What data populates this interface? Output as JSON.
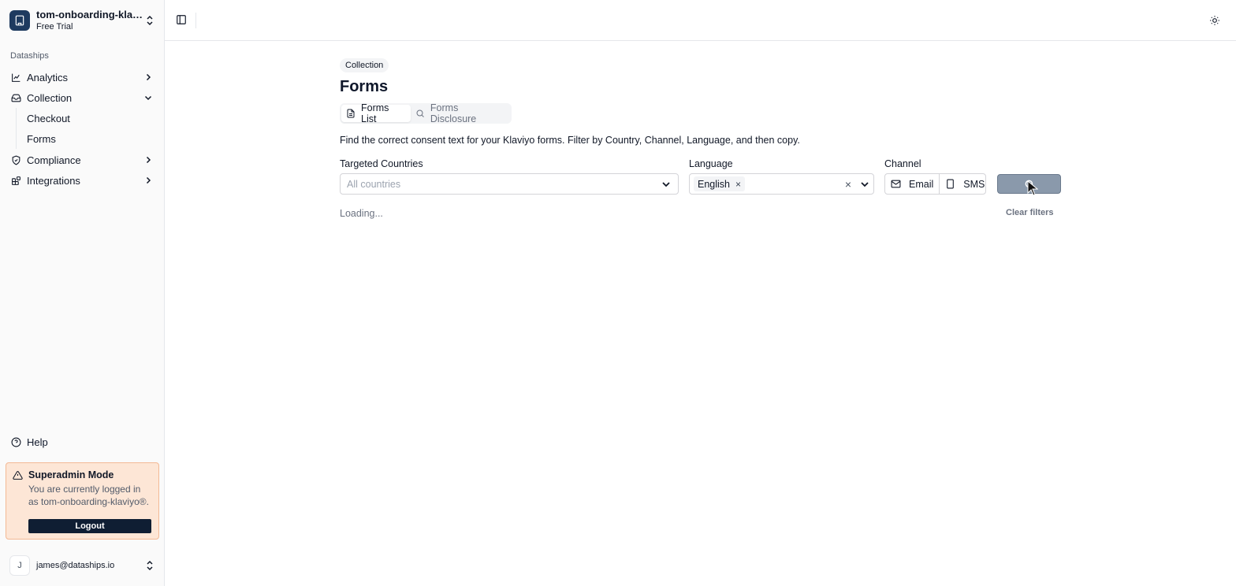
{
  "org": {
    "name": "tom-onboarding-klavi...",
    "plan": "Free Trial"
  },
  "sidebar": {
    "group_label": "Dataships",
    "items": [
      {
        "label": "Analytics",
        "icon": "chart-icon"
      },
      {
        "label": "Collection",
        "icon": "inbox-icon",
        "expanded": true,
        "children": [
          {
            "label": "Checkout"
          },
          {
            "label": "Forms"
          }
        ]
      },
      {
        "label": "Compliance",
        "icon": "shield-check-icon"
      },
      {
        "label": "Integrations",
        "icon": "blocks-icon"
      }
    ],
    "help_label": "Help"
  },
  "superadmin": {
    "title": "Superadmin Mode",
    "message": "You are currently logged in as tom-onboarding-klaviyo®.",
    "logout_label": "Logout"
  },
  "user": {
    "initial": "J",
    "email": "james@dataships.io"
  },
  "page": {
    "breadcrumb": "Collection",
    "title": "Forms",
    "tabs": [
      {
        "label": "Forms List",
        "icon": "file-icon",
        "active": true
      },
      {
        "label": "Forms Disclosure",
        "icon": "search-icon",
        "active": false
      }
    ],
    "description": "Find the correct consent text for your Klaviyo forms. Filter by Country, Channel, Language, and then copy."
  },
  "filters": {
    "countries_label": "Targeted Countries",
    "countries_placeholder": "All countries",
    "language_label": "Language",
    "language_selected": [
      "English"
    ],
    "chip_remove": "×",
    "clear_symbol": "×",
    "channel_label": "Channel",
    "channels": [
      {
        "label": "Email",
        "icon": "mail-icon"
      },
      {
        "label": "SMS",
        "icon": "smartphone-icon"
      }
    ],
    "clear_filters_label": "Clear filters"
  },
  "status": {
    "loading_text": "Loading..."
  },
  "colors": {
    "brand": "#1e3a5f",
    "superadmin_bg": "#fde6d6",
    "logout_bg": "#0f1e33",
    "search_btn": "#8a99ab"
  }
}
